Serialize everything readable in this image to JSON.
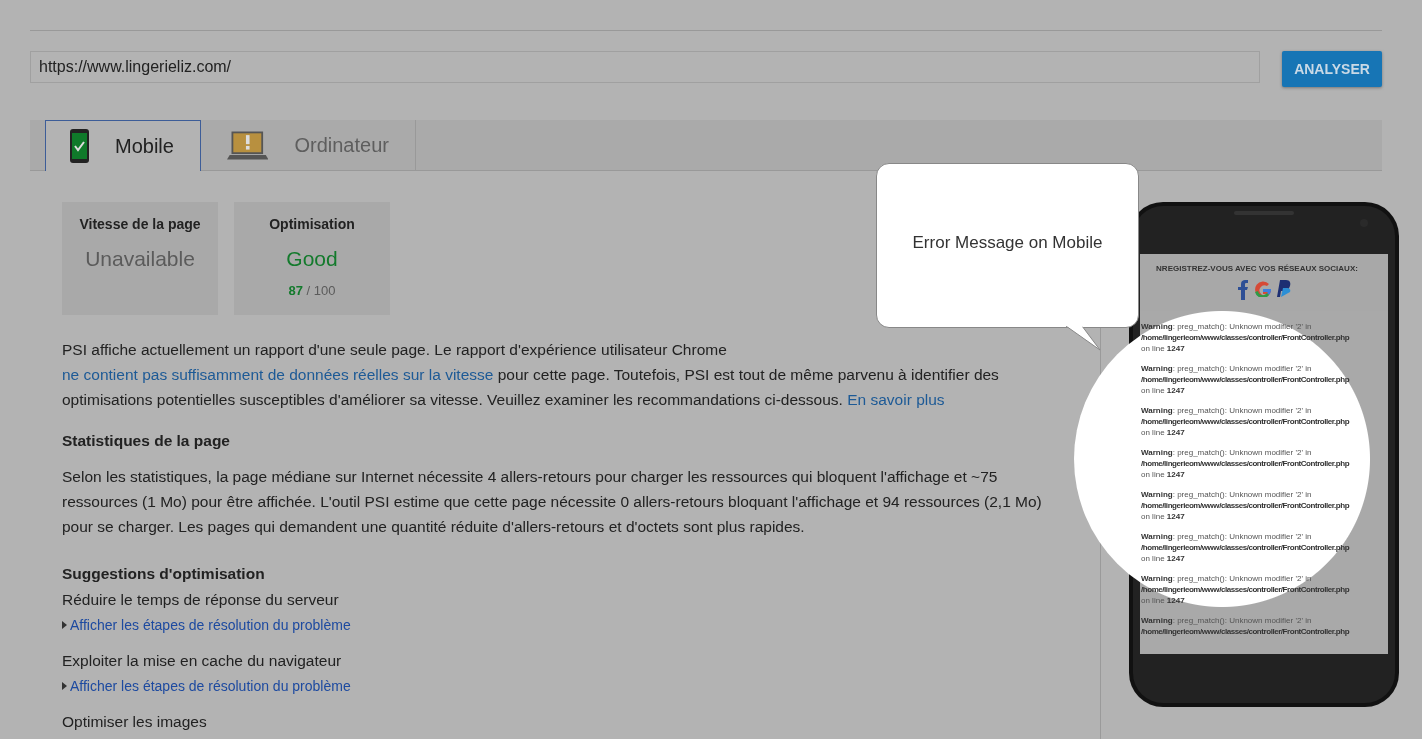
{
  "url_field": {
    "value": "https://www.lingerieliz.com/"
  },
  "analyze_button": "ANALYSER",
  "tabs": [
    {
      "label": "Mobile",
      "kind": "mobile",
      "selected": true
    },
    {
      "label": "Ordinateur",
      "kind": "desktop",
      "selected": false
    }
  ],
  "scores": [
    {
      "title": "Vitesse de la page",
      "value": "Unavailable",
      "color": "#5b5b5b"
    },
    {
      "title": "Optimisation",
      "value": "Good",
      "color": "#137a2c",
      "score": "87",
      "max": "/ 100"
    }
  ],
  "summary": [
    {
      "text": "PSI affiche actuellement un rapport d'une seule page. Le rapport d'expérience utilisateur Chrome "
    },
    {
      "link": "ne contient pas suffisamment de données réelles sur la vitesse"
    },
    {
      "text": " pour cette page. Toutefois, PSI est tout de même parvenu à identifier des optimisations potentielles susceptibles d'améliorer sa vitesse. Veuillez examiner les recommandations ci-dessous. "
    },
    {
      "link": "En savoir plus"
    }
  ],
  "stats": {
    "heading": "Statistiques de la page",
    "text": "Selon les statistiques, la page médiane sur Internet nécessite 4 allers-retours pour charger les ressources qui bloquent l'affichage et ~75 ressources (1 Mo) pour être affichée. L'outil PSI estime que cette page nécessite 0 allers-retours bloquant l'affichage et 94 ressources (2,1 Mo) pour se charger. Les pages qui demandent une quantité réduite d'allers-retours et d'octets sont plus rapides."
  },
  "suggestions": {
    "heading": "Suggestions d'optimisation",
    "items": [
      {
        "title": "Réduire le temps de réponse du serveur",
        "link": "Afficher les étapes de résolution du problème"
      },
      {
        "title": "Exploiter la mise en cache du navigateur",
        "link": "Afficher les étapes de résolution du problème"
      },
      {
        "title": "Optimiser les images"
      }
    ]
  },
  "preview": {
    "banner": "NREGISTREZ-VOUS AVEC VOS RÉSEAUX SOCIAUX:",
    "warnings": [
      {
        "message": "**Warning**: preg_match(): Unknown modifier '2' in",
        "path": "/home/lingerieom/www/classes/controller/FrontController.php",
        "line": "on line **1247**"
      },
      {
        "message": "**Warning**: preg_match(): Unknown modifier '2' in",
        "path": "/home/lingerieom/www/classes/controller/FrontController.php",
        "line": "on line **1247**"
      },
      {
        "message": "**Warning**: preg_match(): Unknown modifier '2' in",
        "path": "/home/lingerieom/www/classes/controller/FrontController.php",
        "line": "on line **1247**"
      },
      {
        "message": "**Warning**: preg_match(): Unknown modifier '2' in",
        "path": "/home/lingerieom/www/classes/controller/FrontController.php",
        "line": "on line **1247**"
      },
      {
        "message": "**Warning**: preg_match(): Unknown modifier '2' in",
        "path": "/home/lingerieom/www/classes/controller/FrontController.php",
        "line": "on line **1247**"
      },
      {
        "message": "**Warning**: preg_match(): Unknown modifier '2' in",
        "path": "/home/lingerieom/www/classes/controller/FrontController.php",
        "line": "on line **1247**"
      },
      {
        "message": "**Warning**: preg_match(): Unknown modifier '2' in",
        "path": "/home/lingerieom/www/classes/controller/FrontController.php",
        "line": "on line **1247**"
      },
      {
        "message": "**Warning**: preg_match(): Unknown modifier '2' in",
        "path": "/home/lingerieom/www/classes/controller/FrontController.php"
      }
    ]
  },
  "callout": "Error Message on Mobile"
}
